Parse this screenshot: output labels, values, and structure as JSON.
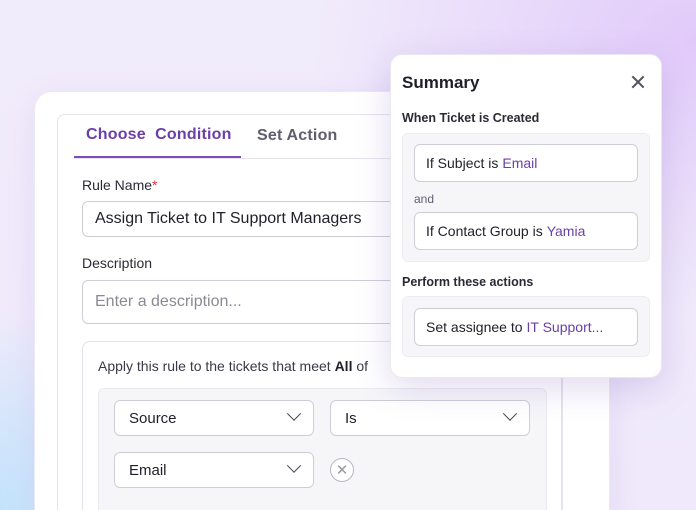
{
  "tabs": [
    {
      "label": "Choose  Condition",
      "active": true
    },
    {
      "label": "Set Action",
      "active": false
    }
  ],
  "form": {
    "rule_name_label": "Rule Name",
    "required_mark": "*",
    "rule_name_value": "Assign Ticket to IT Support Managers",
    "description_label": "Description",
    "description_placeholder": "Enter a description..."
  },
  "rule": {
    "text_prefix": "Apply this rule to the tickets that meet",
    "text_bold": "All",
    "text_suffix": "of",
    "conditions": [
      {
        "field": "Source",
        "operator": "Is",
        "value": "Email"
      }
    ]
  },
  "summary": {
    "title": "Summary",
    "trigger_heading": "When Ticket is Created",
    "conditions": [
      {
        "prefix": "If Subject is",
        "value": "Email"
      },
      {
        "prefix": "If Contact Group is",
        "value": "Yamia"
      }
    ],
    "joiner": "and",
    "actions_heading": "Perform these actions",
    "actions": [
      {
        "prefix": "Set assignee to",
        "value": "IT Support..."
      }
    ]
  },
  "colors": {
    "accent": "#6b3fa8",
    "required": "#d93535"
  }
}
